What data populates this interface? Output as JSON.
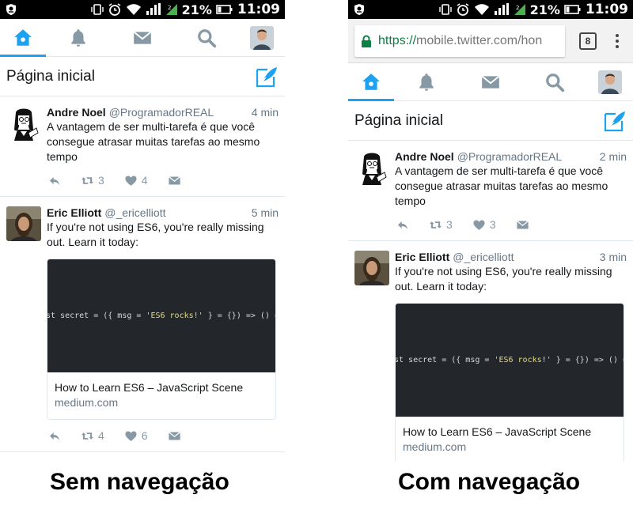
{
  "status_bar": {
    "battery": "21%",
    "time": "11:09"
  },
  "browser": {
    "url_scheme": "https://",
    "url_rest": "mobile.twitter.com/hon",
    "tab_count": "8"
  },
  "nav": {
    "items": [
      "home-icon",
      "bell-icon",
      "envelope-icon",
      "search-icon",
      "avatar"
    ],
    "accent": "#1da1f2"
  },
  "header": {
    "title": "Página inicial"
  },
  "left": {
    "tweets": [
      {
        "name": "Andre Noel",
        "handle": "@ProgramadorREAL",
        "time": "4 min",
        "text": "A vantagem de ser multi-tarefa é que você consegue atrasar muitas tarefas ao mesmo tempo",
        "retweets": "3",
        "likes": "4"
      },
      {
        "name": "Eric Elliott",
        "handle": "@_ericelliott",
        "time": "5 min",
        "text": "If you're not using ES6, you're really missing out. Learn it today:",
        "retweets": "4",
        "likes": "6"
      }
    ],
    "caption": "Sem navegação"
  },
  "right": {
    "tweets": [
      {
        "name": "Andre Noel",
        "handle": "@ProgramadorREAL",
        "time": "2 min",
        "text": "A vantagem de ser multi-tarefa é que você consegue atrasar muitas tarefas ao mesmo tempo",
        "retweets": "3",
        "likes": "3"
      },
      {
        "name": "Eric Elliott",
        "handle": "@_ericelliott",
        "time": "3 min",
        "text": "If you're not using ES6, you're really missing out. Learn it today:"
      }
    ],
    "caption": "Com navegação"
  },
  "card": {
    "code_a": "st secret = ({ msg = ",
    "code_str": "'ES6 rocks!'",
    "code_b": " } = {}) => () => m",
    "title": "How to Learn ES6 – JavaScript Scene",
    "domain": "medium.com"
  }
}
